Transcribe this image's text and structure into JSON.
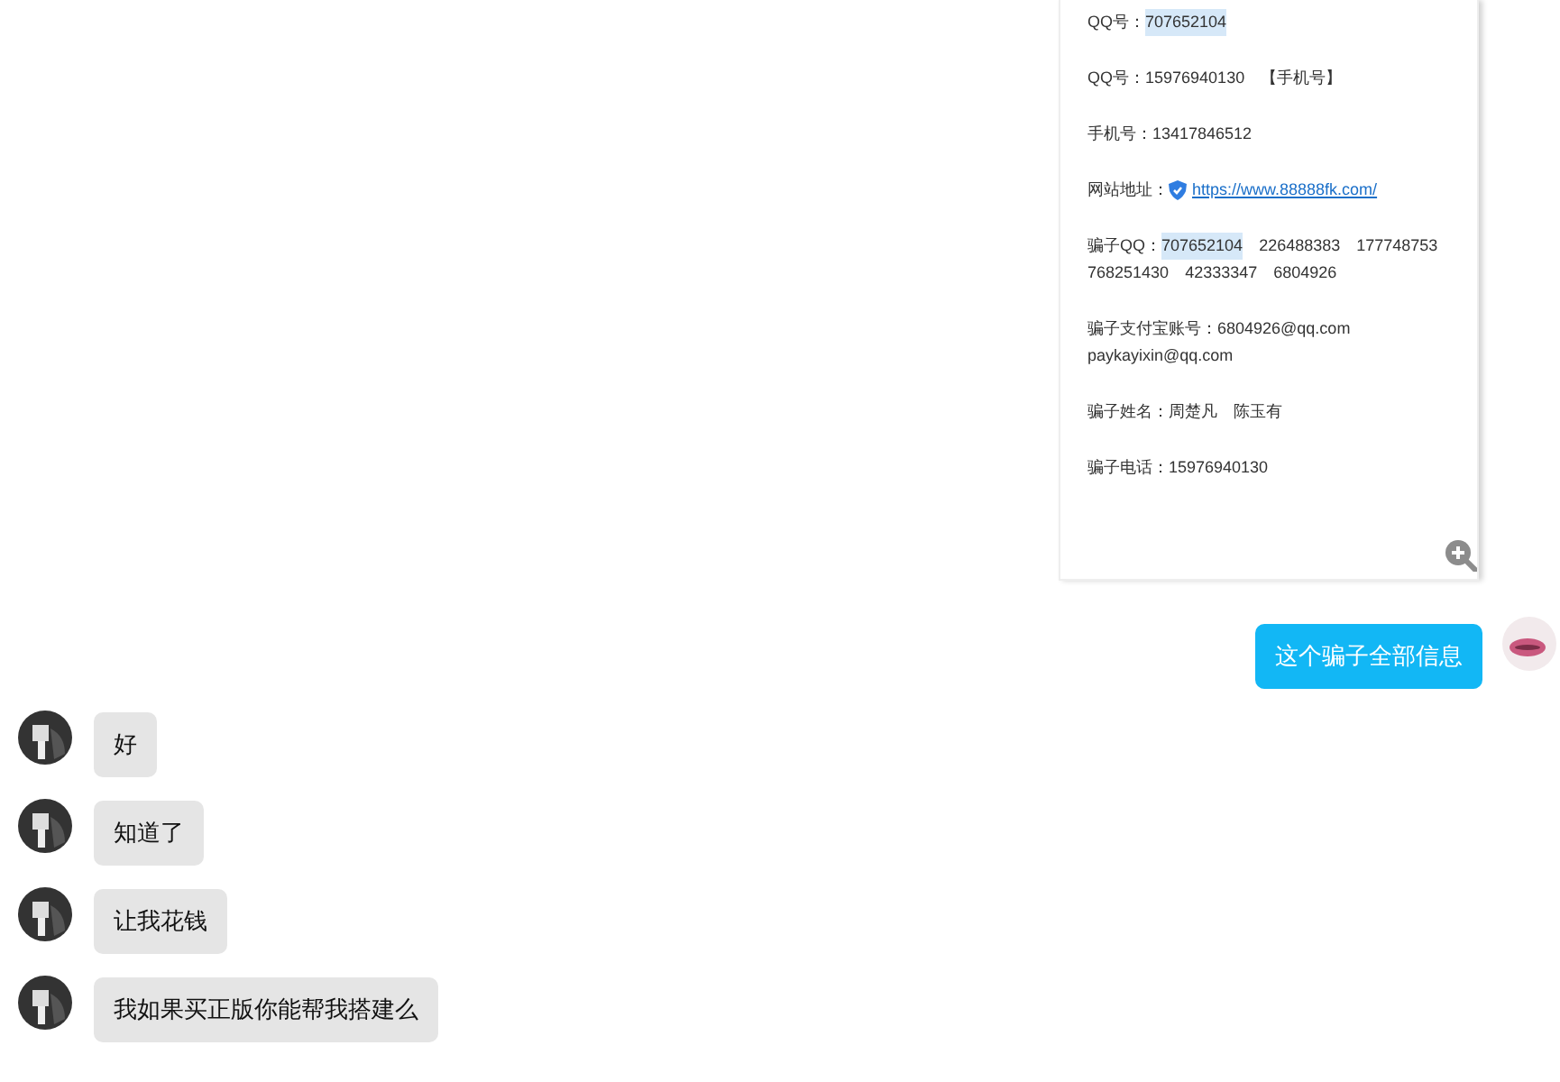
{
  "image_card": {
    "lines": [
      {
        "kind": "text",
        "label": "QQ号：",
        "values": [
          {
            "text": "707652104",
            "highlighted": true
          }
        ]
      },
      {
        "kind": "text",
        "label": "QQ号：",
        "values": [
          {
            "text": "15976940130",
            "highlighted": false
          },
          {
            "text": "【手机号】",
            "highlighted": false
          }
        ]
      },
      {
        "kind": "text",
        "label": "手机号：",
        "values": [
          {
            "text": "13417846512",
            "highlighted": false
          }
        ]
      },
      {
        "kind": "link",
        "label": "网站地址：",
        "values": [
          {
            "text": "https://www.88888fk.com/",
            "highlighted": false
          }
        ]
      },
      {
        "kind": "text",
        "label": "骗子QQ：",
        "values": [
          {
            "text": "707652104",
            "highlighted": true
          },
          {
            "text": "226488383",
            "highlighted": false
          },
          {
            "text": "177748753",
            "highlighted": false
          },
          {
            "text": "768251430",
            "highlighted": false
          },
          {
            "text": "42333347",
            "highlighted": false
          },
          {
            "text": "6804926",
            "highlighted": false
          }
        ]
      },
      {
        "kind": "text",
        "label": "骗子支付宝账号：",
        "values": [
          {
            "text": "6804926@qq.com",
            "highlighted": false
          },
          {
            "text": "paykayixin@qq.com",
            "highlighted": false
          }
        ]
      },
      {
        "kind": "text",
        "label": "骗子姓名：",
        "values": [
          {
            "text": "周楚凡",
            "highlighted": false
          },
          {
            "text": "陈玉有",
            "highlighted": false
          }
        ]
      },
      {
        "kind": "text",
        "label": "骗子电话：",
        "values": [
          {
            "text": "15976940130",
            "highlighted": false
          }
        ]
      }
    ]
  },
  "messages": [
    {
      "kind": "outgoing",
      "text": "这个骗子全部信息"
    },
    {
      "kind": "incoming",
      "text": "好"
    },
    {
      "kind": "incoming",
      "text": "知道了"
    },
    {
      "kind": "incoming",
      "text": "让我花钱"
    },
    {
      "kind": "incoming",
      "text": "我如果买正版你能帮我搭建么"
    }
  ]
}
